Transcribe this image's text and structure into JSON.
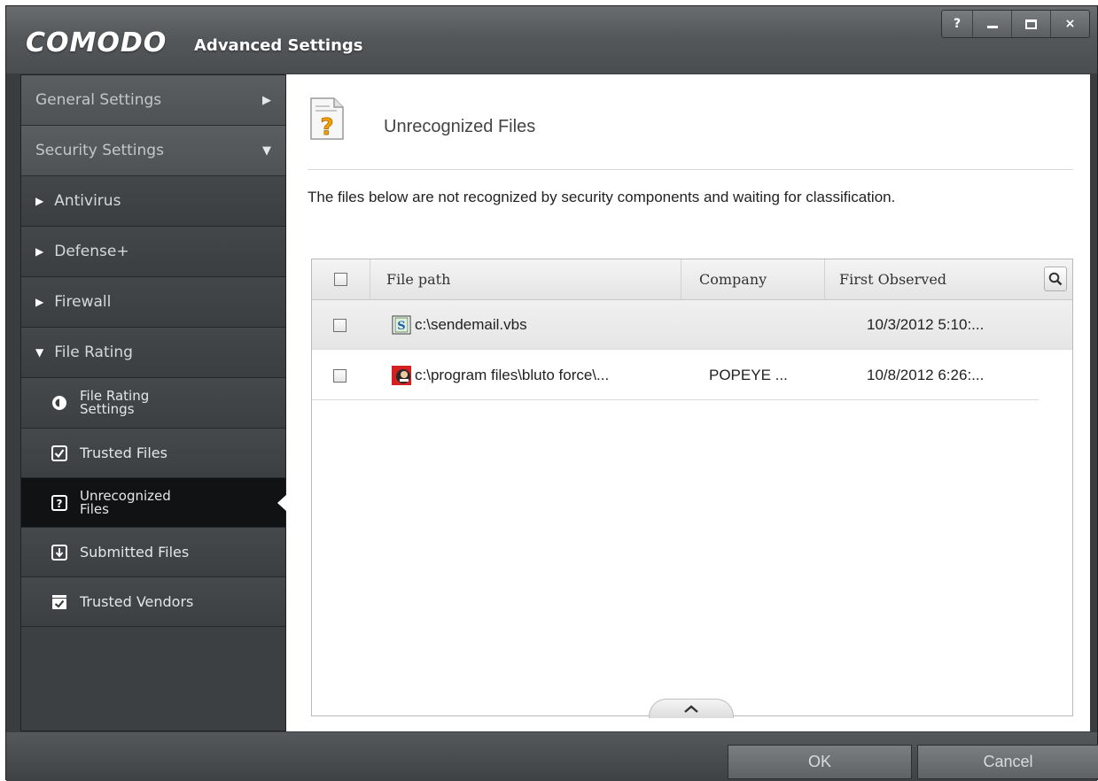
{
  "app": {
    "brand": "COMODO",
    "title": "Advanced Settings",
    "window_buttons": [
      "?",
      "minimize",
      "maximize",
      "×"
    ]
  },
  "sidebar": {
    "general_settings": "General Settings",
    "security_settings": "Security Settings",
    "categories": [
      "Antivirus",
      "Defense+",
      "Firewall",
      "File Rating"
    ],
    "file_rating_items": [
      {
        "label": "File Rating Settings",
        "icon": "settings-circle-icon"
      },
      {
        "label": "Trusted Files",
        "icon": "checked-document-icon"
      },
      {
        "label": "Unrecognized Files",
        "icon": "question-document-icon",
        "active": true
      },
      {
        "label": "Submitted Files",
        "icon": "download-document-icon"
      },
      {
        "label": "Trusted Vendors",
        "icon": "vendor-check-icon"
      }
    ],
    "file_rating_settings_line1": "File Rating",
    "file_rating_settings_line2": "Settings",
    "unrecognized_line1": "Unrecognized",
    "unrecognized_line2": "Files"
  },
  "main": {
    "title": "Unrecognized Files",
    "description": "The files below are not recognized by security components and waiting for classification.",
    "table": {
      "columns": [
        "File path",
        "Company",
        "First Observed"
      ],
      "rows": [
        {
          "path": "c:\\sendemail.vbs",
          "company": "",
          "first_observed": "10/3/2012 5:10:...",
          "icon": "script-file-icon"
        },
        {
          "path": "c:\\program files\\bluto force\\...",
          "company": "POPEYE ...",
          "first_observed": "10/8/2012 6:26:...",
          "icon": "application-file-icon"
        }
      ]
    }
  },
  "footer": {
    "ok": "OK",
    "cancel": "Cancel"
  },
  "colors": {
    "window_bg": "#3a3d40",
    "active_item_bg": "#111213",
    "selected_row_bg": "#eaeaea"
  }
}
